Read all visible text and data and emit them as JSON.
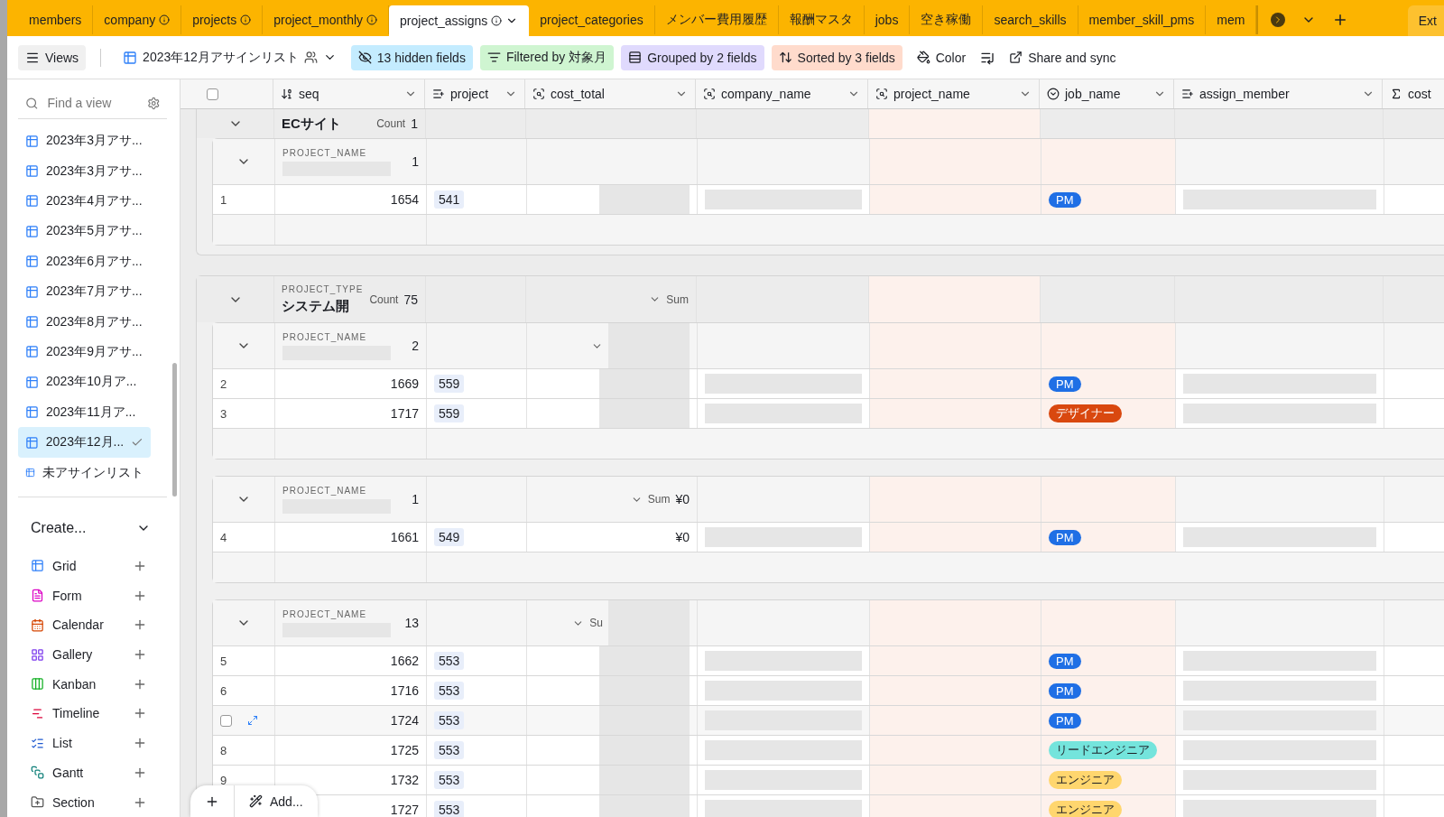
{
  "tabs": [
    {
      "label": "members",
      "info": false,
      "selected": false
    },
    {
      "label": "company",
      "info": true,
      "selected": false
    },
    {
      "label": "projects",
      "info": true,
      "selected": false
    },
    {
      "label": "project_monthly",
      "info": true,
      "selected": false
    },
    {
      "label": "project_assigns",
      "info": true,
      "selected": true
    },
    {
      "label": "project_categories",
      "info": false,
      "selected": false
    },
    {
      "label": "メンバー費用履歴",
      "info": false,
      "selected": false
    },
    {
      "label": "報酬マスタ",
      "info": false,
      "selected": false
    },
    {
      "label": "jobs",
      "info": false,
      "selected": false
    },
    {
      "label": "空き稼働",
      "info": false,
      "selected": false
    },
    {
      "label": "search_skills",
      "info": false,
      "selected": false
    },
    {
      "label": "member_skill_pms",
      "info": false,
      "selected": false
    },
    {
      "label": "mem",
      "info": false,
      "selected": false
    }
  ],
  "extension_tab": "Ext",
  "toolbar": {
    "views_button": "Views",
    "view_name": "2023年12月アサインリスト",
    "chips": [
      {
        "kind": "hidden",
        "label": "13 hidden fields"
      },
      {
        "kind": "filter",
        "label": "Filtered by 対象月"
      },
      {
        "kind": "group",
        "label": "Grouped by 2 fields"
      },
      {
        "kind": "sort",
        "label": "Sorted by 3 fields"
      }
    ],
    "color_button": "Color",
    "share_button": "Share and sync"
  },
  "sidebar": {
    "search_placeholder": "Find a view",
    "views": [
      {
        "label": "2023年3月アサ...",
        "selected": false
      },
      {
        "label": "2023年3月アサ...",
        "selected": false
      },
      {
        "label": "2023年4月アサ...",
        "selected": false
      },
      {
        "label": "2023年5月アサ...",
        "selected": false
      },
      {
        "label": "2023年6月アサ...",
        "selected": false
      },
      {
        "label": "2023年7月アサ...",
        "selected": false
      },
      {
        "label": "2023年8月アサ...",
        "selected": false
      },
      {
        "label": "2023年9月アサ...",
        "selected": false
      },
      {
        "label": "2023年10月ア...",
        "selected": false
      },
      {
        "label": "2023年11月ア...",
        "selected": false
      },
      {
        "label": "2023年12月...",
        "selected": true
      },
      {
        "label": "未アサインリスト",
        "selected": false
      }
    ],
    "create_label": "Create...",
    "create_items": [
      {
        "kind": "grid",
        "label": "Grid"
      },
      {
        "kind": "form",
        "label": "Form"
      },
      {
        "kind": "calendar",
        "label": "Calendar"
      },
      {
        "kind": "gallery",
        "label": "Gallery"
      },
      {
        "kind": "kanban",
        "label": "Kanban"
      },
      {
        "kind": "timeline",
        "label": "Timeline"
      },
      {
        "kind": "list",
        "label": "List"
      },
      {
        "kind": "gantt",
        "label": "Gantt"
      },
      {
        "kind": "section",
        "label": "Section"
      }
    ]
  },
  "select_all": {
    "checked": false
  },
  "columns": [
    {
      "name": "seq",
      "sorted": false
    },
    {
      "name": "project",
      "sorted": false
    },
    {
      "name": "cost_total",
      "sorted": false
    },
    {
      "name": "company_name",
      "sorted": false
    },
    {
      "name": "project_name",
      "sorted": true
    },
    {
      "name": "job_name",
      "sorted": true
    },
    {
      "name": "assign_member",
      "sorted": false
    },
    {
      "name": "cost",
      "sorted": false
    }
  ],
  "groups": [
    {
      "value": "ECサイト",
      "count_label": "Count",
      "count": "1",
      "subgroups": [
        {
          "field": "PROJECT_NAME",
          "count": "1",
          "rows": [
            {
              "number": "1",
              "hovered": false,
              "seq": "1654",
              "project": "541",
              "job": {
                "label": "PM",
                "color": "#1f6fe5"
              }
            }
          ]
        }
      ]
    },
    {
      "field": "PROJECT_TYPE",
      "value": "システム開",
      "count_label": "Count",
      "count": "75",
      "summary": {
        "label": "Sum"
      },
      "subgroups": [
        {
          "field": "PROJECT_NAME",
          "count": "2",
          "summary": {
            "menu": true
          },
          "rows": [
            {
              "number": "2",
              "hovered": false,
              "seq": "1669",
              "project": "559",
              "job": {
                "label": "PM",
                "color": "#1f6fe5"
              }
            },
            {
              "number": "3",
              "hovered": false,
              "seq": "1717",
              "project": "559",
              "job": {
                "label": "デザイナー",
                "color": "#d9480f"
              }
            }
          ]
        },
        {
          "field": "PROJECT_NAME",
          "count": "1",
          "summary": {
            "label": "Sum",
            "value": "¥0"
          },
          "rows": [
            {
              "number": "4",
              "hovered": false,
              "seq": "1661",
              "project": "549",
              "cost_total": "¥0",
              "job": {
                "label": "PM",
                "color": "#1f6fe5"
              }
            }
          ]
        },
        {
          "field": "PROJECT_NAME",
          "count": "13",
          "summary": {
            "label": "Su"
          },
          "rows": [
            {
              "number": "5",
              "hovered": false,
              "seq": "1662",
              "project": "553",
              "job": {
                "label": "PM",
                "color": "#1f6fe5"
              }
            },
            {
              "number": "6",
              "hovered": false,
              "seq": "1716",
              "project": "553",
              "job": {
                "label": "PM",
                "color": "#1f6fe5"
              }
            },
            {
              "hovered": true,
              "seq": "1724",
              "project": "553",
              "job": {
                "label": "PM",
                "color": "#1f6fe5"
              }
            },
            {
              "number": "8",
              "hovered": false,
              "seq": "1725",
              "project": "553",
              "job": {
                "label": "リードエンジニア",
                "color": "#74e4dc"
              }
            },
            {
              "number": "9",
              "hovered": false,
              "seq": "1732",
              "project": "553",
              "job": {
                "label": "エンジニア",
                "color": "#ffd66e"
              }
            },
            {
              "seq": "1727",
              "project": "553",
              "job": {
                "label": "エンジニア",
                "color": "#ffd66e"
              }
            }
          ]
        }
      ]
    }
  ],
  "add_bar": {
    "add_label": "Add..."
  }
}
